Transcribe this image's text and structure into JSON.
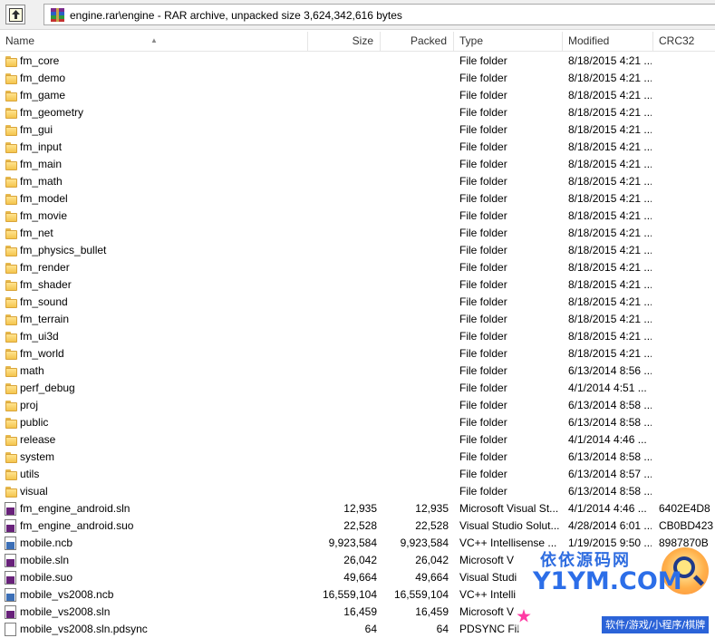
{
  "toolbar": {
    "address": "engine.rar\\engine - RAR archive, unpacked size 3,624,342,616 bytes"
  },
  "columns": {
    "name": "Name",
    "size": "Size",
    "packed": "Packed",
    "type": "Type",
    "modified": "Modified",
    "crc": "CRC32"
  },
  "rows": [
    {
      "name": "fm_core",
      "size": "",
      "packed": "",
      "type": "File folder",
      "modified": "8/18/2015 4:21 ...",
      "crc": "",
      "icon": "folder"
    },
    {
      "name": "fm_demo",
      "size": "",
      "packed": "",
      "type": "File folder",
      "modified": "8/18/2015 4:21 ...",
      "crc": "",
      "icon": "folder"
    },
    {
      "name": "fm_game",
      "size": "",
      "packed": "",
      "type": "File folder",
      "modified": "8/18/2015 4:21 ...",
      "crc": "",
      "icon": "folder"
    },
    {
      "name": "fm_geometry",
      "size": "",
      "packed": "",
      "type": "File folder",
      "modified": "8/18/2015 4:21 ...",
      "crc": "",
      "icon": "folder"
    },
    {
      "name": "fm_gui",
      "size": "",
      "packed": "",
      "type": "File folder",
      "modified": "8/18/2015 4:21 ...",
      "crc": "",
      "icon": "folder"
    },
    {
      "name": "fm_input",
      "size": "",
      "packed": "",
      "type": "File folder",
      "modified": "8/18/2015 4:21 ...",
      "crc": "",
      "icon": "folder"
    },
    {
      "name": "fm_main",
      "size": "",
      "packed": "",
      "type": "File folder",
      "modified": "8/18/2015 4:21 ...",
      "crc": "",
      "icon": "folder"
    },
    {
      "name": "fm_math",
      "size": "",
      "packed": "",
      "type": "File folder",
      "modified": "8/18/2015 4:21 ...",
      "crc": "",
      "icon": "folder"
    },
    {
      "name": "fm_model",
      "size": "",
      "packed": "",
      "type": "File folder",
      "modified": "8/18/2015 4:21 ...",
      "crc": "",
      "icon": "folder"
    },
    {
      "name": "fm_movie",
      "size": "",
      "packed": "",
      "type": "File folder",
      "modified": "8/18/2015 4:21 ...",
      "crc": "",
      "icon": "folder"
    },
    {
      "name": "fm_net",
      "size": "",
      "packed": "",
      "type": "File folder",
      "modified": "8/18/2015 4:21 ...",
      "crc": "",
      "icon": "folder"
    },
    {
      "name": "fm_physics_bullet",
      "size": "",
      "packed": "",
      "type": "File folder",
      "modified": "8/18/2015 4:21 ...",
      "crc": "",
      "icon": "folder"
    },
    {
      "name": "fm_render",
      "size": "",
      "packed": "",
      "type": "File folder",
      "modified": "8/18/2015 4:21 ...",
      "crc": "",
      "icon": "folder"
    },
    {
      "name": "fm_shader",
      "size": "",
      "packed": "",
      "type": "File folder",
      "modified": "8/18/2015 4:21 ...",
      "crc": "",
      "icon": "folder"
    },
    {
      "name": "fm_sound",
      "size": "",
      "packed": "",
      "type": "File folder",
      "modified": "8/18/2015 4:21 ...",
      "crc": "",
      "icon": "folder"
    },
    {
      "name": "fm_terrain",
      "size": "",
      "packed": "",
      "type": "File folder",
      "modified": "8/18/2015 4:21 ...",
      "crc": "",
      "icon": "folder"
    },
    {
      "name": "fm_ui3d",
      "size": "",
      "packed": "",
      "type": "File folder",
      "modified": "8/18/2015 4:21 ...",
      "crc": "",
      "icon": "folder"
    },
    {
      "name": "fm_world",
      "size": "",
      "packed": "",
      "type": "File folder",
      "modified": "8/18/2015 4:21 ...",
      "crc": "",
      "icon": "folder"
    },
    {
      "name": "math",
      "size": "",
      "packed": "",
      "type": "File folder",
      "modified": "6/13/2014 8:56 ...",
      "crc": "",
      "icon": "folder"
    },
    {
      "name": "perf_debug",
      "size": "",
      "packed": "",
      "type": "File folder",
      "modified": "4/1/2014 4:51 ...",
      "crc": "",
      "icon": "folder"
    },
    {
      "name": "proj",
      "size": "",
      "packed": "",
      "type": "File folder",
      "modified": "6/13/2014 8:58 ...",
      "crc": "",
      "icon": "folder"
    },
    {
      "name": "public",
      "size": "",
      "packed": "",
      "type": "File folder",
      "modified": "6/13/2014 8:58 ...",
      "crc": "",
      "icon": "folder"
    },
    {
      "name": "release",
      "size": "",
      "packed": "",
      "type": "File folder",
      "modified": "4/1/2014 4:46 ...",
      "crc": "",
      "icon": "folder"
    },
    {
      "name": "system",
      "size": "",
      "packed": "",
      "type": "File folder",
      "modified": "6/13/2014 8:58 ...",
      "crc": "",
      "icon": "folder"
    },
    {
      "name": "utils",
      "size": "",
      "packed": "",
      "type": "File folder",
      "modified": "6/13/2014 8:57 ...",
      "crc": "",
      "icon": "folder"
    },
    {
      "name": "visual",
      "size": "",
      "packed": "",
      "type": "File folder",
      "modified": "6/13/2014 8:58 ...",
      "crc": "",
      "icon": "folder"
    },
    {
      "name": "fm_engine_android.sln",
      "size": "12,935",
      "packed": "12,935",
      "type": "Microsoft Visual St...",
      "modified": "4/1/2014 4:46 ...",
      "crc": "6402E4D8",
      "icon": "vs-file"
    },
    {
      "name": "fm_engine_android.suo",
      "size": "22,528",
      "packed": "22,528",
      "type": "Visual Studio Solut...",
      "modified": "4/28/2014 6:01 ...",
      "crc": "CB0BD423",
      "icon": "vs-file"
    },
    {
      "name": "mobile.ncb",
      "size": "9,923,584",
      "packed": "9,923,584",
      "type": "VC++ Intellisense ...",
      "modified": "1/19/2015 9:50 ...",
      "crc": "8987870B",
      "icon": "ncb-file"
    },
    {
      "name": "mobile.sln",
      "size": "26,042",
      "packed": "26,042",
      "type": "Microsoft V",
      "modified": "",
      "crc": "",
      "icon": "vs-file"
    },
    {
      "name": "mobile.suo",
      "size": "49,664",
      "packed": "49,664",
      "type": "Visual Studi",
      "modified": "",
      "crc": "",
      "icon": "vs-file"
    },
    {
      "name": "mobile_vs2008.ncb",
      "size": "16,559,104",
      "packed": "16,559,104",
      "type": "VC++ Intelli",
      "modified": "",
      "crc": "",
      "icon": "ncb-file"
    },
    {
      "name": "mobile_vs2008.sln",
      "size": "16,459",
      "packed": "16,459",
      "type": "Microsoft V",
      "modified": "",
      "crc": "",
      "icon": "vs-file"
    },
    {
      "name": "mobile_vs2008.sln.pdsync",
      "size": "64",
      "packed": "64",
      "type": "PDSYNC Fil",
      "modified": "",
      "crc": "",
      "icon": "blank-file"
    }
  ],
  "watermark": {
    "line1": "依依源码网",
    "line2": "Y1YM.COM",
    "line3": "软件/游戏/小程序/棋牌"
  }
}
